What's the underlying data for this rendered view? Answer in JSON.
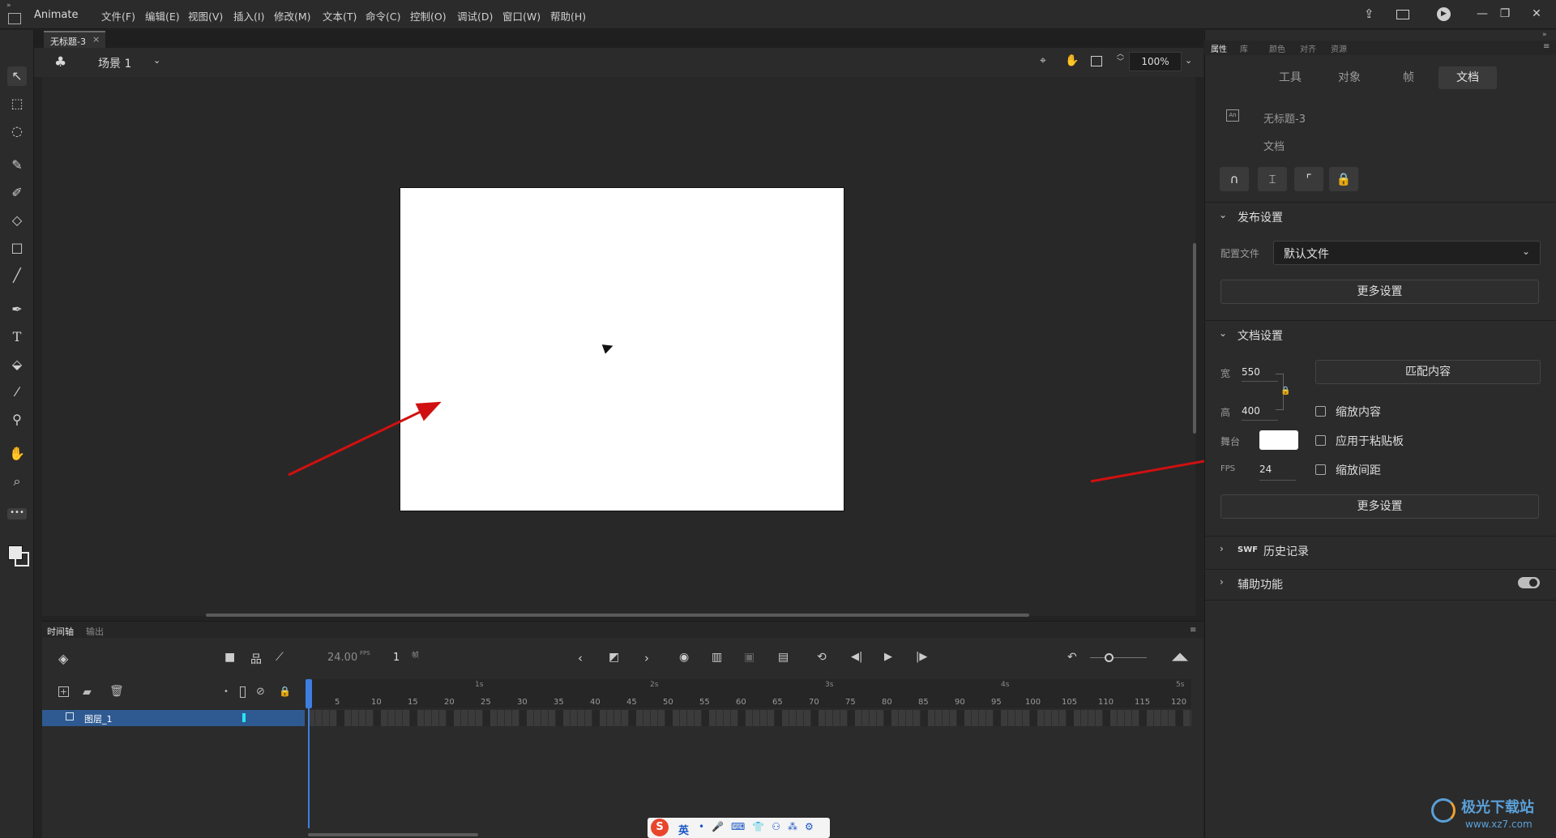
{
  "app": {
    "name": "Animate",
    "doc_title": "无标题-3"
  },
  "menu": [
    "文件(F)",
    "编辑(E)",
    "视图(V)",
    "插入(I)",
    "修改(M)",
    "文本(T)",
    "命令(C)",
    "控制(O)",
    "调试(D)",
    "窗口(W)",
    "帮助(H)"
  ],
  "window_controls": [
    "—",
    "❐",
    "✕"
  ],
  "stage": {
    "scene_label": "场景 1",
    "zoom": "100%",
    "cursor": "▶"
  },
  "tools": [
    "selection-icon",
    "free-transform-icon",
    "lasso-icon",
    "paint-brush-icon",
    "brush-icon",
    "eraser-icon",
    "rectangle-icon",
    "line-icon",
    "pen-icon",
    "text-icon",
    "paint-bucket-icon",
    "eyedropper-icon",
    "pin-icon",
    "hand-icon",
    "zoom-icon"
  ],
  "timeline": {
    "tabs": [
      "时间轴",
      "输出"
    ],
    "fps": "24.00",
    "fps_unit": "FPS",
    "frame": "1",
    "frame_unit": "帧",
    "layer_name": "图层_1",
    "ticks": [
      "5",
      "10",
      "15",
      "20",
      "25",
      "30",
      "35",
      "40",
      "45",
      "50",
      "55",
      "60",
      "65",
      "70",
      "75",
      "80",
      "85",
      "90",
      "95",
      "100",
      "105",
      "110",
      "115",
      "120"
    ],
    "seconds": [
      "1s",
      "2s",
      "3s",
      "4s",
      "5s"
    ]
  },
  "panel": {
    "tabs": [
      "属性",
      "库",
      "颜色",
      "对齐",
      "资源"
    ],
    "subtabs": [
      "工具",
      "对象",
      "帧",
      "文档"
    ],
    "doc_name": "无标题-3",
    "doc_type": "文档",
    "publish": {
      "title": "发布设置",
      "profile_label": "配置文件",
      "profile_value": "默认文件",
      "more_button": "更多设置"
    },
    "document": {
      "title": "文档设置",
      "width_label": "宽",
      "width_value": "550",
      "height_label": "高",
      "height_value": "400",
      "stage_label": "舞台",
      "stage_color": "#ffffff",
      "fps_label": "FPS",
      "fps_value": "24",
      "match_button": "匹配内容",
      "checkbox_scale_content": "缩放内容",
      "checkbox_apply_pasteboard": "应用于粘贴板",
      "checkbox_scale_spacing": "缩放间距",
      "more_button": "更多设置"
    },
    "swf_history": {
      "prefix": "SWF",
      "title": "历史记录"
    },
    "accessibility": {
      "title": "辅助功能"
    }
  },
  "ime": {
    "label": "英"
  },
  "watermark": {
    "name": "极光下载站",
    "url": "www.xz7.com"
  },
  "colors": {
    "accent": "#3d7ee0",
    "arrow": "#d01010"
  }
}
